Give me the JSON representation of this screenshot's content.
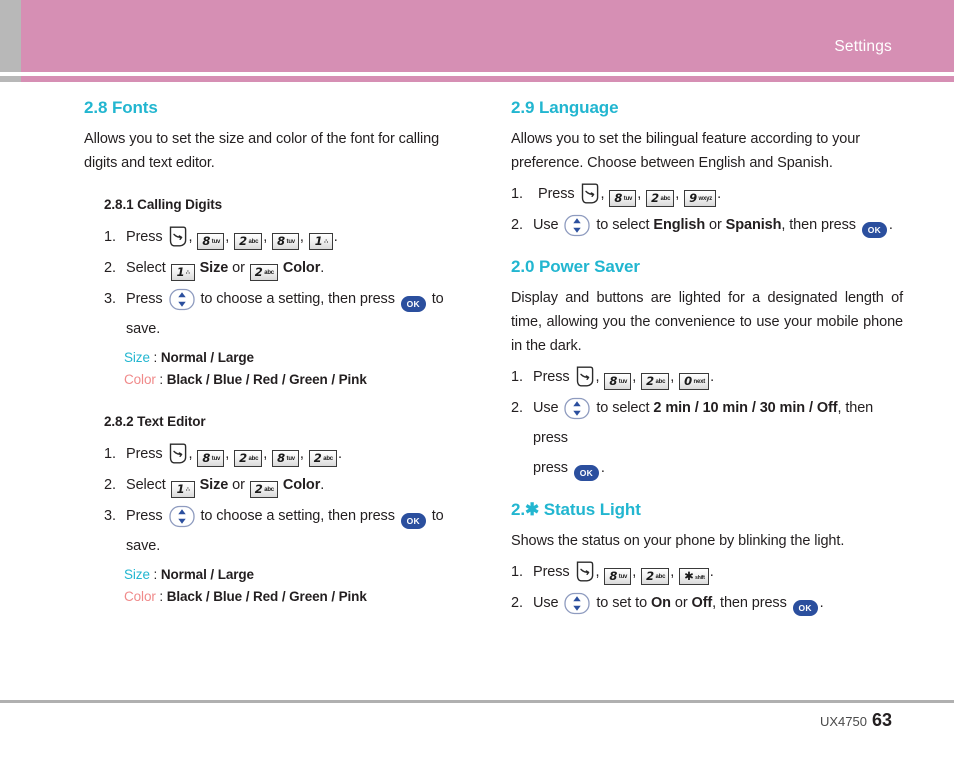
{
  "header": {
    "title": "Settings",
    "bar_color": "#d68fb4",
    "tab_color": "#b8b8b8"
  },
  "theme": {
    "heading_color": "#22b6d0",
    "size_label_color": "#22b6d0",
    "color_label_color": "#f08a8a",
    "key_blue": "#2b4f9e",
    "text_color": "#231f20"
  },
  "icons": {
    "send": "send-key-icon",
    "nav": "nav-updown-key-icon",
    "ok": "ok-key-icon",
    "ok_label": "OK"
  },
  "keys": {
    "k8": {
      "digit": "8",
      "sub": "tuv"
    },
    "k2": {
      "digit": "2",
      "sub": "abc"
    },
    "k1": {
      "digit": "1",
      "sub": "∴"
    },
    "k9": {
      "digit": "9",
      "sub": "wxyz"
    },
    "k0": {
      "digit": "0",
      "sub": "next"
    },
    "kstar": {
      "digit": "✱",
      "sub": "shift"
    }
  },
  "left_column": {
    "section": {
      "heading": "2.8 Fonts",
      "intro": "Allows you to set the size and color of the font for calling digits and text editor."
    },
    "subsections": [
      {
        "heading": "2.8.1 Calling Digits",
        "steps": [
          {
            "num": "1.",
            "lead": "Press",
            "keys": [
              "send",
              "k8",
              "k2",
              "k8",
              "k1"
            ]
          },
          {
            "num": "2.",
            "lead": "Select",
            "select_keys": [
              {
                "key": "k1",
                "label": "Size"
              },
              {
                "key": "k2",
                "label": "Color"
              }
            ],
            "joiner": "or",
            "tail": "."
          },
          {
            "num": "3.",
            "lead": "Press",
            "nav": true,
            "mid": "to choose a setting, then press",
            "ok": true,
            "tail": "to save."
          }
        ],
        "values": [
          {
            "label": "Size",
            "label_type": "size",
            "options": "Normal / Large"
          },
          {
            "label": "Color",
            "label_type": "color",
            "options": "Black / Blue / Red / Green / Pink"
          }
        ]
      },
      {
        "heading": "2.8.2 Text Editor",
        "steps": [
          {
            "num": "1.",
            "lead": "Press",
            "keys": [
              "send",
              "k8",
              "k2",
              "k8",
              "k2"
            ]
          },
          {
            "num": "2.",
            "lead": "Select",
            "select_keys": [
              {
                "key": "k1",
                "label": "Size"
              },
              {
                "key": "k2",
                "label": "Color"
              }
            ],
            "joiner": "or",
            "tail": "."
          },
          {
            "num": "3.",
            "lead": "Press",
            "nav": true,
            "mid": "to choose a setting, then press",
            "ok": true,
            "tail": "to save."
          }
        ],
        "values": [
          {
            "label": "Size",
            "label_type": "size",
            "options": "Normal / Large"
          },
          {
            "label": "Color",
            "label_type": "color",
            "options": "Black / Blue / Red / Green / Pink"
          }
        ]
      }
    ]
  },
  "right_column": {
    "sections": [
      {
        "heading": "2.9 Language",
        "intro": "Allows you to set the bilingual feature according to your preference. Choose between English and Spanish.",
        "steps": [
          {
            "num": "1.",
            "lead": "Press",
            "keys": [
              "send",
              "k8",
              "k2",
              "k9"
            ]
          },
          {
            "num": "2.",
            "lead": "Use",
            "nav": true,
            "mid": "to select",
            "opt_a": "English",
            "joiner": "or",
            "opt_b": "Spanish",
            "mid2": ", then press",
            "ok": true,
            "tail": "."
          }
        ]
      },
      {
        "heading": "2.0 Power Saver",
        "intro": "Display and buttons are lighted for a designated length of time, allowing you the convenience to use your mobile phone in the dark.",
        "steps": [
          {
            "num": "1.",
            "lead": "Press",
            "keys": [
              "send",
              "k8",
              "k2",
              "k0"
            ]
          },
          {
            "num": "2.",
            "lead": "Use",
            "nav": true,
            "mid": "to select",
            "options_bold": "2 min / 10 min / 30 min / Off",
            "mid2": ", then press",
            "ok": true,
            "tail": "."
          }
        ]
      },
      {
        "heading": "2.✱ Status Light",
        "intro": "Shows the status on your phone by blinking the light.",
        "steps": [
          {
            "num": "1.",
            "lead": "Press",
            "keys": [
              "send",
              "k8",
              "k2",
              "kstar"
            ]
          },
          {
            "num": "2.",
            "lead": "Use",
            "nav": true,
            "mid": "to set to",
            "opt_a": "On",
            "joiner": "or",
            "opt_b": "Off",
            "mid2": ", then press",
            "ok": true,
            "tail": "."
          }
        ]
      }
    ]
  },
  "footer": {
    "model": "UX4750",
    "page": "63"
  }
}
